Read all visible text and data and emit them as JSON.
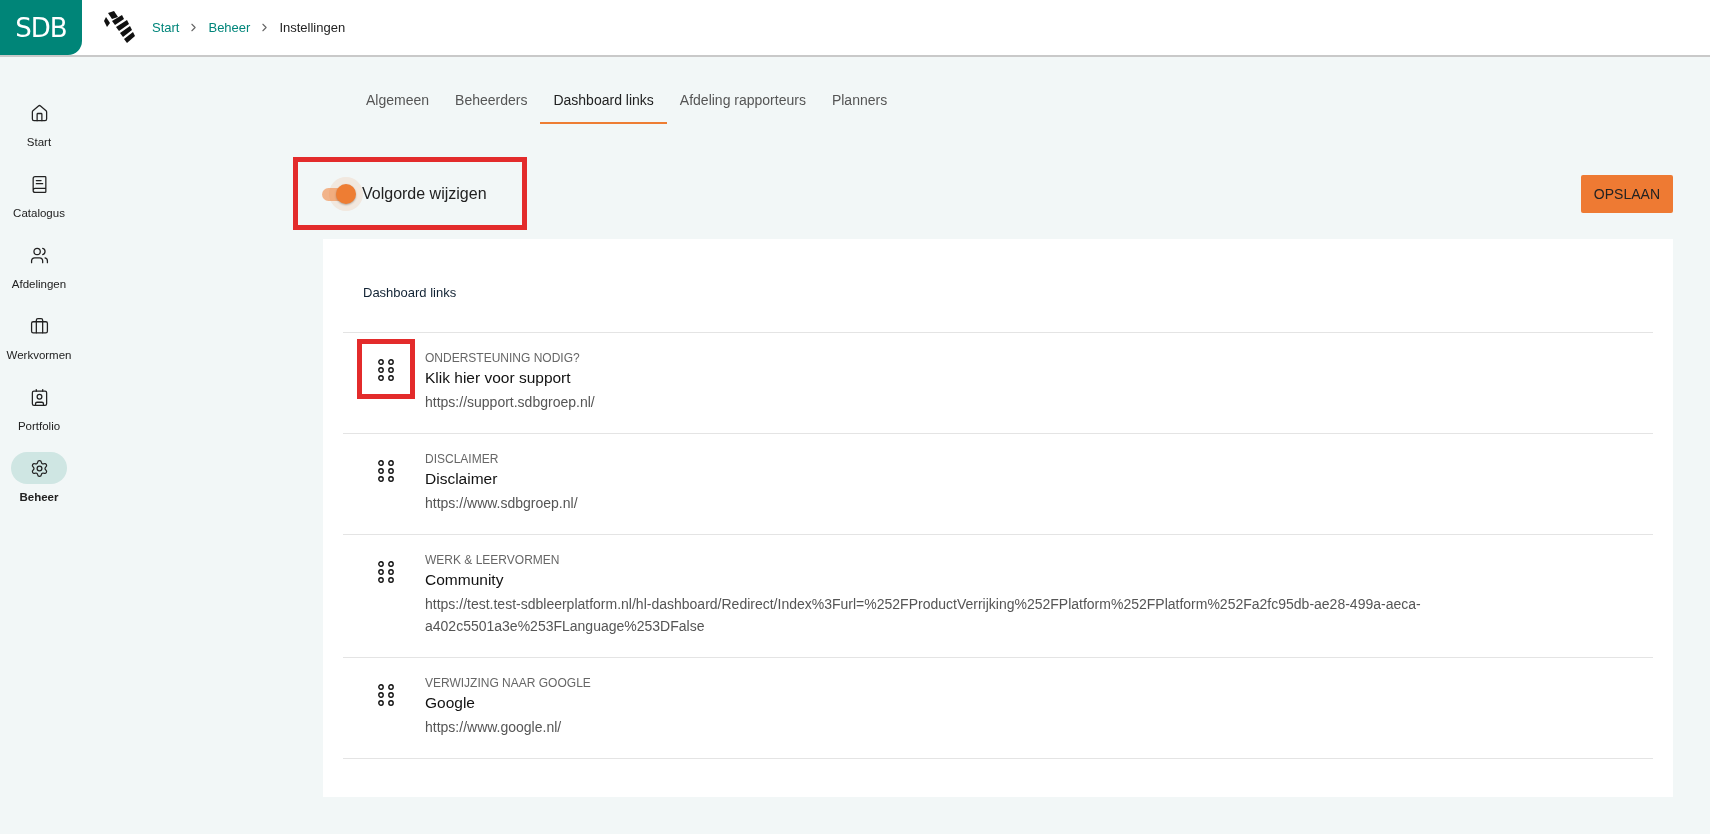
{
  "header": {
    "logo": "SDB",
    "breadcrumb": [
      {
        "label": "Start",
        "link": true
      },
      {
        "label": "Beheer",
        "link": true
      },
      {
        "label": "Instellingen",
        "link": false
      }
    ]
  },
  "sidebar": {
    "items": [
      {
        "label": "Start",
        "kind": "home",
        "selected": false
      },
      {
        "label": "Catalogus",
        "kind": "book",
        "selected": false
      },
      {
        "label": "Afdelingen",
        "kind": "users",
        "selected": false
      },
      {
        "label": "Werkvormen",
        "kind": "briefcase",
        "selected": false
      },
      {
        "label": "Portfolio",
        "kind": "card",
        "selected": false
      },
      {
        "label": "Beheer",
        "kind": "gear",
        "selected": true
      }
    ]
  },
  "tabs": [
    {
      "label": "Algemeen",
      "selected": false
    },
    {
      "label": "Beheerders",
      "selected": false
    },
    {
      "label": "Dashboard links",
      "selected": true
    },
    {
      "label": "Afdeling rapporteurs",
      "selected": false
    },
    {
      "label": "Planners",
      "selected": false
    }
  ],
  "reorder_toggle": {
    "label": "Volgorde wijzigen",
    "on": true,
    "highlighted": true
  },
  "save_button": "OPSLAAN",
  "card": {
    "title": "Dashboard links",
    "links": [
      {
        "category": "ONDERSTEUNING NODIG?",
        "title": "Klik hier voor support",
        "url": "https://support.sdbgroep.nl/",
        "highlighted": true
      },
      {
        "category": "DISCLAIMER",
        "title": "Disclaimer",
        "url": "https://www.sdbgroep.nl/",
        "highlighted": false
      },
      {
        "category": "WERK & LEERVORMEN",
        "title": "Community",
        "url": "https://test.test-sdbleerplatform.nl/hl-dashboard/Redirect/Index%3Furl=%252FProductVerrijking%252FPlatform%252FPlatform%252Fa2fc95db-ae28-499a-aeca-a402c5501a3e%253FLanguage%253DFalse",
        "highlighted": false
      },
      {
        "category": "VERWIJZING NAAR GOOGLE",
        "title": "Google",
        "url": "https://www.google.nl/",
        "highlighted": false
      }
    ]
  }
}
